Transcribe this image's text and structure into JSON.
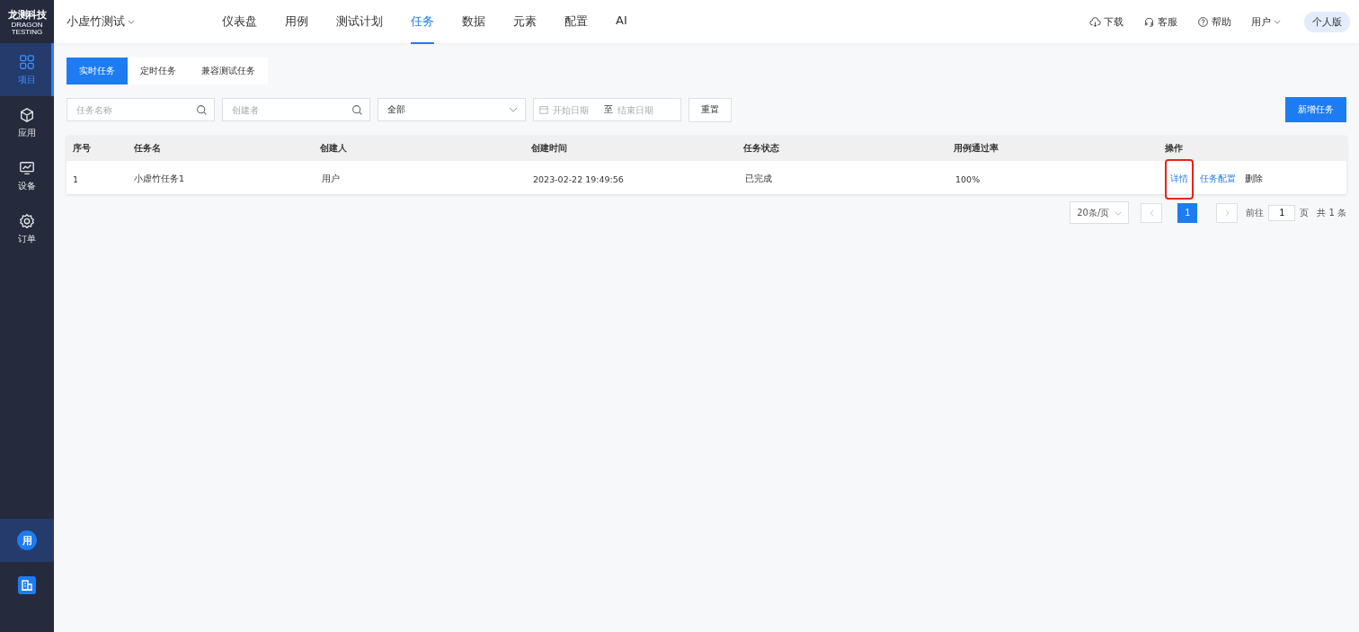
{
  "logo": {
    "title": "龙测科技",
    "subtitle": "DRAGON TESTING"
  },
  "sidebar": {
    "items": [
      {
        "label": "项目",
        "selected": true
      },
      {
        "label": "应用",
        "selected": false
      },
      {
        "label": "设备",
        "selected": false
      },
      {
        "label": "订单",
        "selected": false
      }
    ],
    "avatar": "用"
  },
  "project": "小虚竹测试",
  "nav": [
    {
      "label": "仪表盘",
      "selected": false
    },
    {
      "label": "用例",
      "selected": false
    },
    {
      "label": "测试计划",
      "selected": false
    },
    {
      "label": "任务",
      "selected": true
    },
    {
      "label": "数据",
      "selected": false
    },
    {
      "label": "元素",
      "selected": false
    },
    {
      "label": "配置",
      "selected": false
    },
    {
      "label": "AI",
      "selected": false
    }
  ],
  "header_actions": [
    {
      "label": "下载"
    },
    {
      "label": "客服"
    },
    {
      "label": "帮助"
    }
  ],
  "user": "用户",
  "edition": "个人版",
  "tabs": [
    {
      "label": "实时任务",
      "selected": true
    },
    {
      "label": "定时任务",
      "selected": false
    },
    {
      "label": "兼容测试任务",
      "selected": false
    }
  ],
  "filters": {
    "name_placeholder": "任务名称",
    "creator_placeholder": "创建者",
    "status": "全部",
    "start_placeholder": "开始日期",
    "range_separator": "至",
    "end_placeholder": "结束日期",
    "reset": "重置"
  },
  "add_button": "新增任务",
  "table": {
    "columns": [
      "序号",
      "任务名",
      "创建人",
      "创建时间",
      "任务状态",
      "用例通过率",
      "操作"
    ],
    "rows": [
      {
        "cells": [
          "1",
          "小虚竹任务1",
          "用户",
          "2023-02-22 19:49:56",
          "已完成",
          "100%"
        ],
        "actions": [
          {
            "label": "详情",
            "kind": "link",
            "highlighted": true
          },
          {
            "label": "任务配置",
            "kind": "link",
            "highlighted": false
          },
          {
            "label": "删除",
            "kind": "plain",
            "highlighted": false
          }
        ]
      }
    ]
  },
  "pagination": {
    "page_size": "20条/页",
    "pages": [
      {
        "label": "1",
        "selected": true
      }
    ],
    "goto_label": "前往",
    "goto_value": "1",
    "page_unit": "页",
    "total": "共 1 条"
  }
}
